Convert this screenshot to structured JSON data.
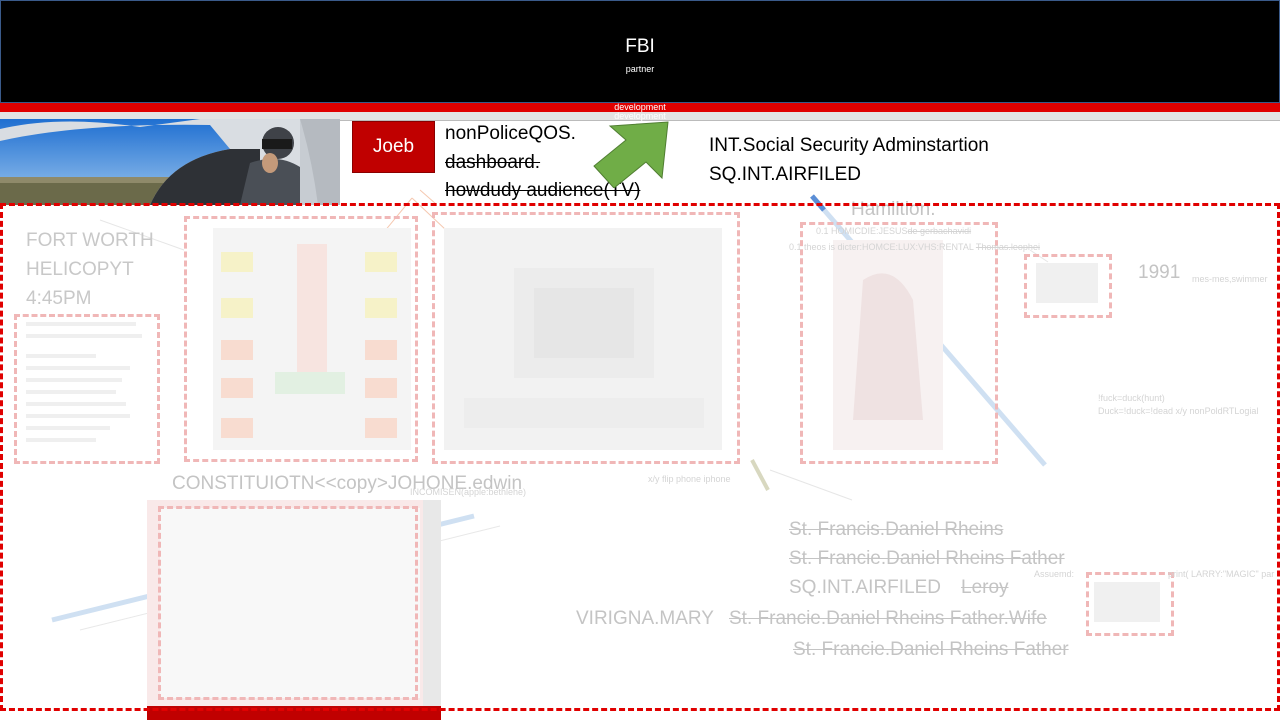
{
  "header": {
    "title": "FBI",
    "subtitle": "partner",
    "band_label_1": "development",
    "band_label_2": "development"
  },
  "colors": {
    "header_bg": "#000000",
    "accent_red": "#e00000",
    "button_red": "#c00000",
    "arrow_green": "#70ad47"
  },
  "badge": {
    "label": "Joeb"
  },
  "notes": {
    "line1": "nonPoliceQOS.",
    "line2": "dashboard.",
    "line3": "howdudy audience(TV)"
  },
  "agency": {
    "line1": "INT.Social Security Adminstartion",
    "line2": "SQ.INT.AIRFILED"
  },
  "faded": {
    "fort_worth": [
      "FORT WORTH",
      "HELICOPYT",
      "4:45PM"
    ],
    "constitution": "CONSTITUIOTN<<copy>JOHONE.edwin",
    "st_francis_1": "St. Francis.Daniel Rheins",
    "st_francis_2": "St. Francie.Daniel Rheins Father",
    "sq_int": "SQ.INT.AIRFILED",
    "leroy": "Leroy",
    "virigna": "VIRIGNA.MARY",
    "st_francis_wife": "St. Francie.Daniel Rheins Father.Wife",
    "st_francis_3": "St. Francie.Daniel Rheins Father",
    "hamilton": "Hamiltion.",
    "year": "1991",
    "small_1": "0.1 HOMICDIE:JESUS",
    "small_1b": "de gerbachavidi",
    "small_2": "0.1 theos is dicter:HOMCE:LUX:VHS:RENTAL",
    "small_2b": "Thomas.leophei",
    "small_3": "x/y flip phone iphone",
    "small_4": "!fuck=duck(hunt)",
    "small_5": "Duck=!duck=!dead x/y nonPoldRTLogial",
    "small_6": "Assuemd:",
    "small_7": "print( LARRY:\"MAGIC\" par",
    "small_8": "mes-mes,swimmer",
    "small_9": "INCOMISEN(apple:bethlehe)"
  }
}
